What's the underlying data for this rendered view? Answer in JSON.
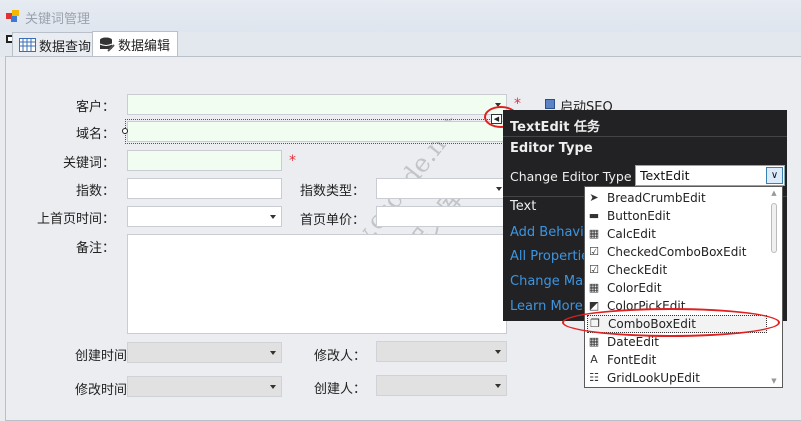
{
  "window": {
    "title": "关键词管理",
    "icon": "app-icon"
  },
  "tabs": [
    {
      "label": "数据查询",
      "icon": "grid-icon",
      "active": false
    },
    {
      "label": "数据编辑",
      "icon": "database-edit-icon",
      "active": true
    }
  ],
  "form": {
    "customer": {
      "label": "客户：",
      "required": "*"
    },
    "domain": {
      "label": "域名："
    },
    "keyword": {
      "label": "关键词：",
      "required": "*"
    },
    "index": {
      "label": "指数："
    },
    "index_type": {
      "label": "指数类型："
    },
    "homepage_time": {
      "label": "上首页时间："
    },
    "homepage_price": {
      "label": "首页单价："
    },
    "remark": {
      "label": "备注："
    },
    "created_time": {
      "label": "创建时间："
    },
    "modifier": {
      "label": "修改人："
    },
    "modified_time": {
      "label": "修改时间："
    },
    "creator": {
      "label": "创建人："
    },
    "seo": {
      "label": "启动SEO",
      "checked": false
    }
  },
  "smart_tag": {
    "title": "TextEdit 任务",
    "section": "Editor Type",
    "change_label": "Change Editor Type",
    "selected_type": "TextEdit",
    "text_label": "Text",
    "links": [
      "Add Behavio",
      "All Propertie",
      "Change Mas",
      "Learn More"
    ]
  },
  "editor_types": [
    {
      "label": "BreadCrumbEdit",
      "icon": "breadcrumb-icon"
    },
    {
      "label": "ButtonEdit",
      "icon": "button-icon"
    },
    {
      "label": "CalcEdit",
      "icon": "calculator-icon"
    },
    {
      "label": "CheckedComboBoxEdit",
      "icon": "checked-combo-icon"
    },
    {
      "label": "CheckEdit",
      "icon": "checkbox-icon"
    },
    {
      "label": "ColorEdit",
      "icon": "color-grid-icon"
    },
    {
      "label": "ColorPickEdit",
      "icon": "color-pick-icon"
    },
    {
      "label": "ComboBoxEdit",
      "icon": "combobox-icon",
      "highlighted": true
    },
    {
      "label": "DateEdit",
      "icon": "calendar-icon"
    },
    {
      "label": "FontEdit",
      "icon": "font-icon"
    },
    {
      "label": "GridLookUpEdit",
      "icon": "grid-lookup-icon"
    }
  ],
  "watermark": {
    "line1": "www.cscode.net",
    "line2": "开发框架文库"
  },
  "colors": {
    "required": "#e0303a",
    "highlight_circle": "#e02020",
    "link": "#3d95e0",
    "popup_bg": "#222224",
    "required_field_bg": "#f0fdf0"
  }
}
